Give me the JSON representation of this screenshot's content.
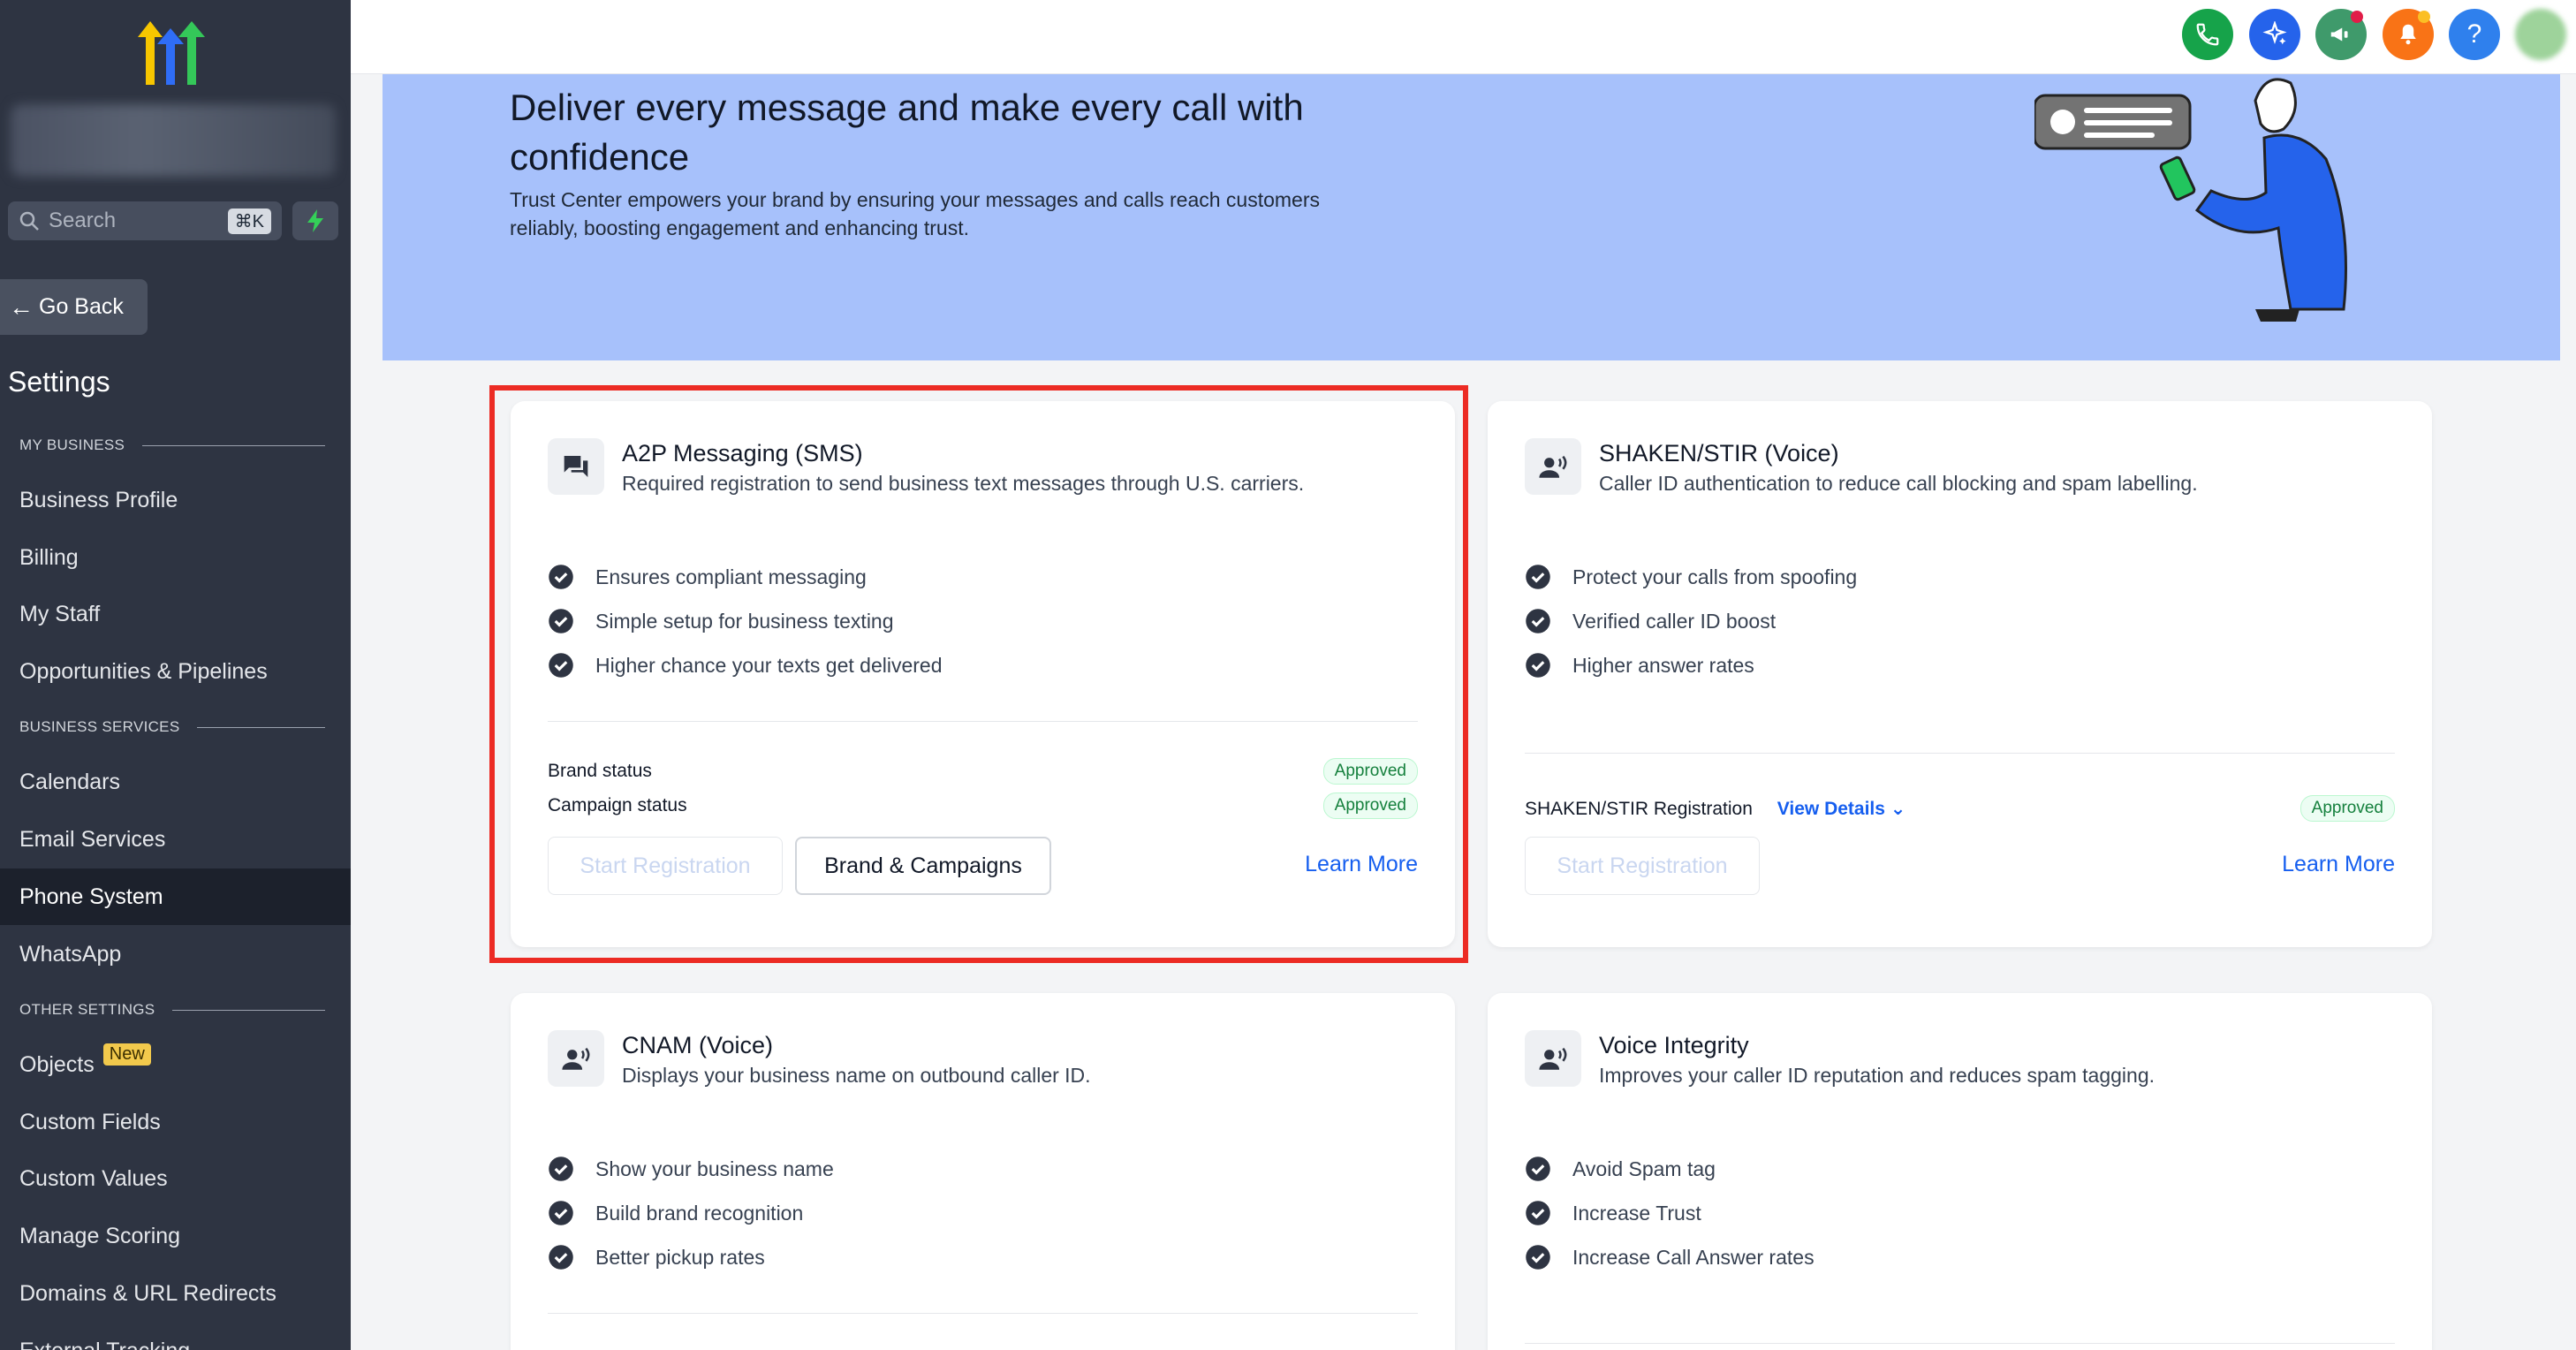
{
  "sidebar": {
    "search_label": "Search",
    "search_shortcut": "⌘K",
    "go_back": "Go Back",
    "settings_title": "Settings",
    "sections": [
      {
        "header": "MY BUSINESS",
        "items": [
          "Business Profile",
          "Billing",
          "My Staff",
          "Opportunities & Pipelines"
        ]
      },
      {
        "header": "BUSINESS SERVICES",
        "items": [
          "Calendars",
          "Email Services",
          "Phone System",
          "WhatsApp"
        ]
      },
      {
        "header": "OTHER SETTINGS",
        "items": [
          "Objects",
          "Custom Fields",
          "Custom Values",
          "Manage Scoring",
          "Domains & URL Redirects",
          "External Tracking"
        ]
      }
    ],
    "active_item": "Phone System",
    "objects_badge": "New"
  },
  "topbar": {
    "icons": [
      "phone-icon",
      "sparkle-icon",
      "megaphone-icon",
      "bell-icon",
      "help-icon",
      "avatar"
    ],
    "colors": {
      "phone": "#16a34a",
      "sparkle": "#2563eb",
      "megaphone": "#3f9a6b",
      "bell": "#f97316",
      "help": "#2f80ed"
    }
  },
  "hero": {
    "title": "Deliver every message and make every call with confidence",
    "description": "Trust Center empowers your brand by ensuring your messages and calls reach customers reliably, boosting engagement and enhancing trust."
  },
  "cards": {
    "a2p": {
      "title": "A2P Messaging (SMS)",
      "subtitle": "Required registration to send business text messages through U.S. carriers.",
      "features": [
        "Ensures compliant messaging",
        "Simple setup for business texting",
        "Higher chance your texts get delivered"
      ],
      "brand_status_label": "Brand status",
      "brand_status": "Approved",
      "campaign_status_label": "Campaign status",
      "campaign_status": "Approved",
      "start_registration": "Start Registration",
      "brand_campaigns": "Brand & Campaigns",
      "learn_more": "Learn More"
    },
    "shaken": {
      "title": "SHAKEN/STIR (Voice)",
      "subtitle": "Caller ID authentication to reduce call blocking and spam labelling.",
      "features": [
        "Protect your calls from spoofing",
        "Verified caller ID boost",
        "Higher answer rates"
      ],
      "registration_label": "SHAKEN/STIR Registration",
      "view_details": "View Details",
      "status": "Approved",
      "start_registration": "Start Registration",
      "learn_more": "Learn More"
    },
    "cnam": {
      "title": "CNAM (Voice)",
      "subtitle": "Displays your business name on outbound caller ID.",
      "features": [
        "Show your business name",
        "Build brand recognition",
        "Better pickup rates"
      ]
    },
    "voice_integrity": {
      "title": "Voice Integrity",
      "subtitle": "Improves your caller ID reputation and reduces spam tagging.",
      "features": [
        "Avoid Spam tag",
        "Increase Trust",
        "Increase Call Answer rates"
      ]
    }
  }
}
